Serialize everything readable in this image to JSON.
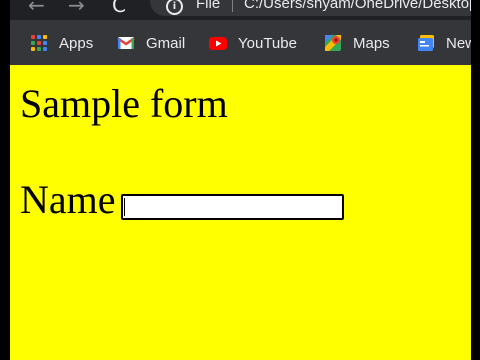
{
  "browser": {
    "nav": {
      "back_icon": "←",
      "forward_icon": "→",
      "reload_icon": "C"
    },
    "address_bar": {
      "scheme": "File",
      "url": "C:/Users/shyam/OneDrive/Desktop/sample.html"
    }
  },
  "bookmarks": [
    {
      "label": "Apps",
      "icon": "apps-grid-icon"
    },
    {
      "label": "Gmail",
      "icon": "gmail-icon"
    },
    {
      "label": "YouTube",
      "icon": "youtube-icon"
    },
    {
      "label": "Maps",
      "icon": "maps-icon"
    },
    {
      "label": "News",
      "icon": "news-icon"
    }
  ],
  "page": {
    "background": "#ffff00",
    "heading": "Sample form",
    "form": {
      "name_label": "Name",
      "name_value": ""
    }
  }
}
